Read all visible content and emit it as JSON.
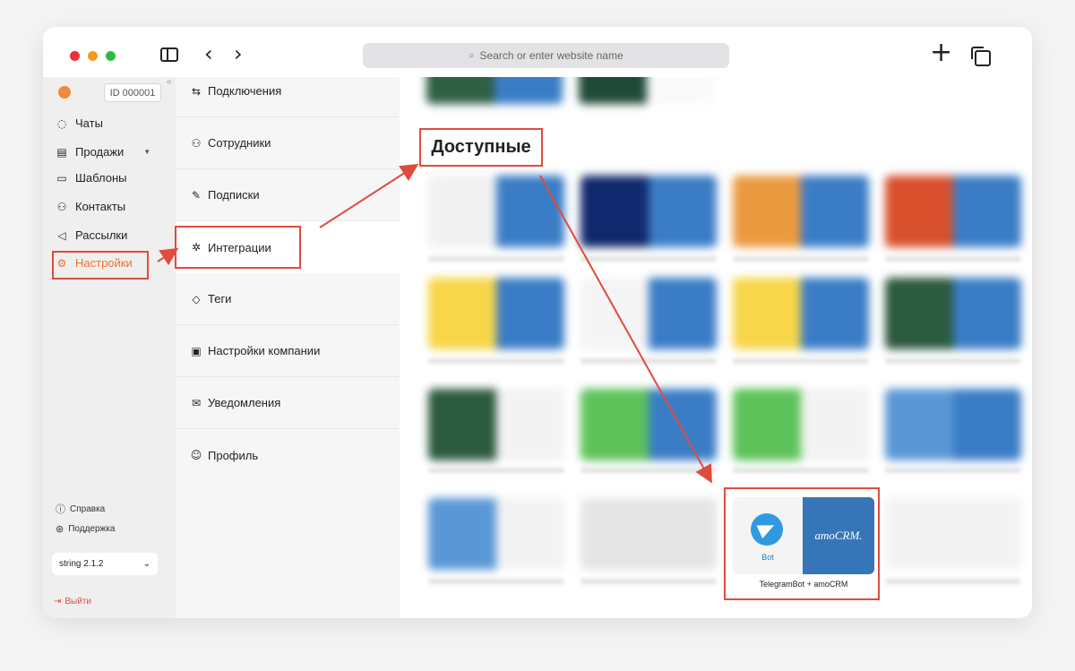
{
  "browser": {
    "address_placeholder": "Search or enter website name"
  },
  "sidebar": {
    "account_id": "ID 000001",
    "items": [
      {
        "label": "Чаты",
        "icon": "chat-icon"
      },
      {
        "label": "Продажи",
        "icon": "shop-icon"
      },
      {
        "label": "Шаблоны",
        "icon": "template-icon"
      },
      {
        "label": "Контакты",
        "icon": "contacts-icon"
      },
      {
        "label": "Рассылки",
        "icon": "megaphone-icon"
      },
      {
        "label": "Настройки",
        "icon": "gear-icon"
      }
    ],
    "help": "Справка",
    "support": "Поддержка",
    "version": "string 2.1.2",
    "logout": "Выйти"
  },
  "settings_menu": {
    "items": [
      {
        "label": "Подключения",
        "icon": "link-icon"
      },
      {
        "label": "Сотрудники",
        "icon": "users-icon"
      },
      {
        "label": "Подписки",
        "icon": "subscription-icon"
      },
      {
        "label": "Интеграции",
        "icon": "puzzle-icon"
      },
      {
        "label": "Теги",
        "icon": "tag-icon"
      },
      {
        "label": "Настройки компании",
        "icon": "company-icon"
      },
      {
        "label": "Уведомления",
        "icon": "mail-icon"
      },
      {
        "label": "Профиль",
        "icon": "profile-icon"
      }
    ]
  },
  "content": {
    "section_title": "Доступные",
    "highlight_card": {
      "left_label": "Bot",
      "right_label": "amoCRM.",
      "caption": "TelegramBot + amoCRM"
    }
  },
  "colors": {
    "accent": "#f0702d",
    "annotation": "#e04c3c",
    "telegram_blue": "#2f9ae0",
    "amocrm_blue": "#3775b9"
  }
}
